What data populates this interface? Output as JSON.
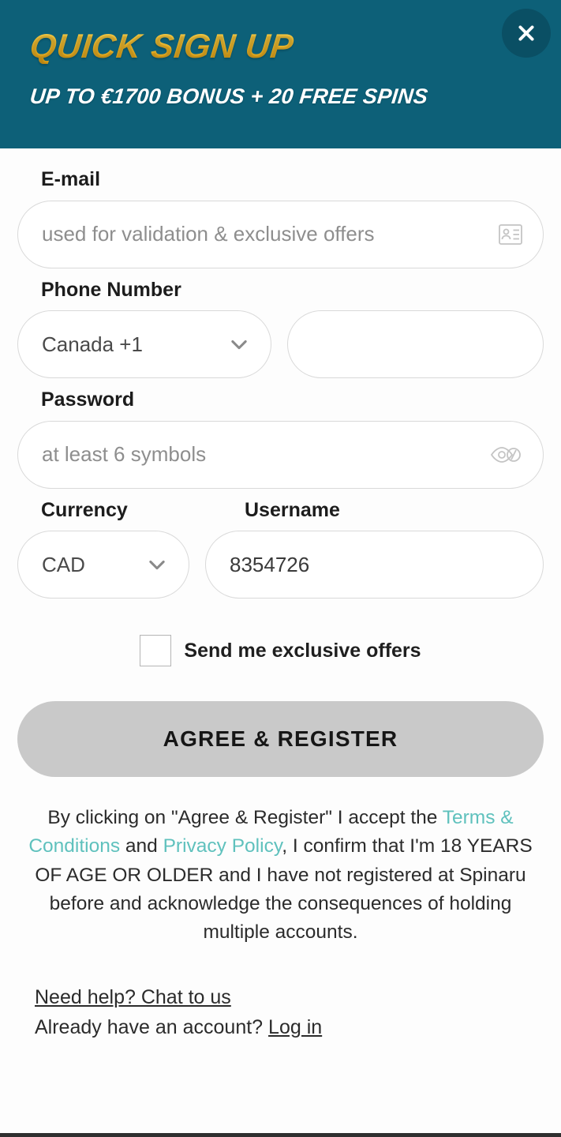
{
  "header": {
    "title": "QUICK SIGN UP",
    "subtitle": "UP TO €1700 BONUS + 20 FREE SPINS",
    "close_icon": "close-icon",
    "background_color": "#0d6078",
    "title_color": "#f2b827",
    "close_button_color": "#0a4f64"
  },
  "form": {
    "email": {
      "label": "E-mail",
      "placeholder": "used for validation & exclusive offers",
      "value": "",
      "icon": "contact-card-icon"
    },
    "phone": {
      "label": "Phone Number",
      "country_code_value": "Canada +1",
      "country_code_icon": "chevron-down-icon",
      "number_placeholder": "",
      "number_value": ""
    },
    "password": {
      "label": "Password",
      "placeholder": "at least 6 symbols",
      "value": "",
      "icon": "eye-toggle-icon"
    },
    "currency": {
      "label": "Currency",
      "value": "CAD",
      "icon": "chevron-down-icon"
    },
    "username": {
      "label": "Username",
      "value": "8354726",
      "placeholder": ""
    },
    "offers_checkbox": {
      "label": "Send me exclusive offers",
      "checked": false
    },
    "submit_label": "AGREE & REGISTER",
    "submit_color": "#c9c9c9"
  },
  "legal": {
    "part1": "By clicking on \"Agree & Register\" I accept the ",
    "terms_link": "Terms & Conditions",
    "part2": " and ",
    "privacy_link": "Privacy Policy",
    "part3": ", I confirm that I'm 18 YEARS OF AGE OR OLDER and I have not registered at Spinaru before and acknowledge the consequences of holding multiple accounts.",
    "link_color": "#5fc1bd"
  },
  "footer": {
    "help_link": "Need help? Chat to us",
    "account_prompt": "Already have an account? ",
    "login_link": "Log in"
  }
}
